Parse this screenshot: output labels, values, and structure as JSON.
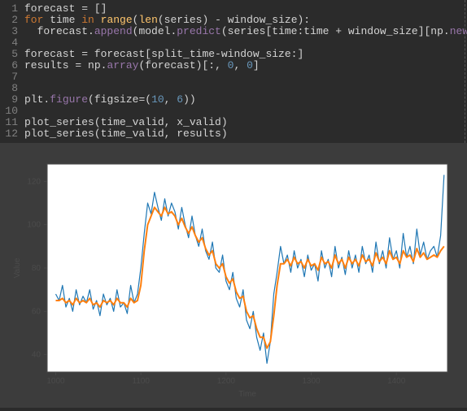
{
  "code": {
    "lines": [
      {
        "n": "1",
        "tokens": [
          {
            "t": "id",
            "v": "forecast "
          },
          {
            "t": "ws",
            "v": "= []"
          }
        ]
      },
      {
        "n": "2",
        "tokens": [
          {
            "t": "kw",
            "v": "for "
          },
          {
            "t": "id",
            "v": "time "
          },
          {
            "t": "kw",
            "v": "in "
          },
          {
            "t": "fn",
            "v": "range"
          },
          {
            "t": "ws",
            "v": "("
          },
          {
            "t": "fn",
            "v": "len"
          },
          {
            "t": "ws",
            "v": "(series) - window_size):"
          }
        ]
      },
      {
        "n": "3",
        "tokens": [
          {
            "t": "ws",
            "v": "  forecast."
          },
          {
            "t": "attr",
            "v": "append"
          },
          {
            "t": "ws",
            "v": "(model."
          },
          {
            "t": "attr",
            "v": "predict"
          },
          {
            "t": "ws",
            "v": "(series[time:time + window_size][np."
          },
          {
            "t": "attr",
            "v": "newaxis"
          },
          {
            "t": "ws",
            "v": "]))"
          }
        ]
      },
      {
        "n": "4",
        "tokens": []
      },
      {
        "n": "5",
        "tokens": [
          {
            "t": "id",
            "v": "forecast "
          },
          {
            "t": "ws",
            "v": "= forecast[split_time-window_size:]"
          }
        ]
      },
      {
        "n": "6",
        "tokens": [
          {
            "t": "id",
            "v": "results "
          },
          {
            "t": "ws",
            "v": "= np."
          },
          {
            "t": "attr",
            "v": "array"
          },
          {
            "t": "ws",
            "v": "(forecast)[:, "
          },
          {
            "t": "num",
            "v": "0"
          },
          {
            "t": "ws",
            "v": ", "
          },
          {
            "t": "num",
            "v": "0"
          },
          {
            "t": "ws",
            "v": "]"
          }
        ]
      },
      {
        "n": "7",
        "tokens": []
      },
      {
        "n": "8",
        "tokens": []
      },
      {
        "n": "9",
        "tokens": [
          {
            "t": "id",
            "v": "plt."
          },
          {
            "t": "attr",
            "v": "figure"
          },
          {
            "t": "ws",
            "v": "("
          },
          {
            "t": "id",
            "v": "figsize"
          },
          {
            "t": "ws",
            "v": "=("
          },
          {
            "t": "num",
            "v": "10"
          },
          {
            "t": "ws",
            "v": ", "
          },
          {
            "t": "num",
            "v": "6"
          },
          {
            "t": "ws",
            "v": "))"
          }
        ]
      },
      {
        "n": "10",
        "tokens": []
      },
      {
        "n": "11",
        "tokens": [
          {
            "t": "id",
            "v": "plot_series(time_valid, x_valid)"
          }
        ]
      },
      {
        "n": "12",
        "tokens": [
          {
            "t": "id",
            "v": "plot_series(time_valid, results)"
          }
        ]
      }
    ]
  },
  "chart_data": {
    "type": "line",
    "xlabel": "Time",
    "ylabel": "Value",
    "xlim": [
      990,
      1460
    ],
    "ylim": [
      32,
      128
    ],
    "xticks": [
      1000,
      1100,
      1200,
      1300,
      1400
    ],
    "yticks": [
      40,
      60,
      80,
      100,
      120
    ],
    "series": [
      {
        "name": "x_valid",
        "color": "#1f77b4",
        "x": [
          1000,
          1004,
          1008,
          1012,
          1016,
          1020,
          1024,
          1028,
          1032,
          1036,
          1040,
          1044,
          1048,
          1052,
          1056,
          1060,
          1064,
          1068,
          1072,
          1076,
          1080,
          1084,
          1088,
          1092,
          1096,
          1100,
          1104,
          1108,
          1112,
          1116,
          1120,
          1124,
          1128,
          1132,
          1136,
          1140,
          1144,
          1148,
          1152,
          1156,
          1160,
          1164,
          1168,
          1172,
          1176,
          1180,
          1184,
          1188,
          1192,
          1196,
          1200,
          1204,
          1208,
          1212,
          1216,
          1220,
          1224,
          1228,
          1232,
          1236,
          1240,
          1244,
          1248,
          1252,
          1256,
          1260,
          1264,
          1268,
          1272,
          1276,
          1280,
          1284,
          1288,
          1292,
          1296,
          1300,
          1304,
          1308,
          1312,
          1316,
          1320,
          1324,
          1328,
          1332,
          1336,
          1340,
          1344,
          1348,
          1352,
          1356,
          1360,
          1364,
          1368,
          1372,
          1376,
          1380,
          1384,
          1388,
          1392,
          1396,
          1400,
          1404,
          1408,
          1412,
          1416,
          1420,
          1424,
          1428,
          1432,
          1436,
          1440,
          1444,
          1448,
          1452,
          1456
        ],
        "y": [
          68,
          65,
          72,
          62,
          66,
          60,
          70,
          63,
          67,
          64,
          70,
          61,
          65,
          58,
          68,
          63,
          66,
          60,
          70,
          62,
          64,
          59,
          72,
          64,
          68,
          80,
          96,
          110,
          105,
          115,
          108,
          102,
          112,
          104,
          110,
          106,
          98,
          108,
          100,
          94,
          104,
          95,
          90,
          98,
          88,
          84,
          92,
          80,
          78,
          86,
          74,
          70,
          78,
          66,
          62,
          70,
          56,
          52,
          60,
          48,
          42,
          50,
          36,
          46,
          68,
          78,
          90,
          82,
          86,
          78,
          88,
          80,
          84,
          76,
          86,
          79,
          82,
          74,
          88,
          80,
          84,
          76,
          90,
          80,
          85,
          77,
          88,
          80,
          86,
          78,
          90,
          82,
          86,
          78,
          92,
          82,
          88,
          80,
          94,
          84,
          88,
          80,
          96,
          85,
          90,
          82,
          98,
          86,
          92,
          84,
          88,
          90,
          85,
          95,
          123
        ]
      },
      {
        "name": "results",
        "color": "#ff7f0e",
        "x": [
          1000,
          1004,
          1008,
          1012,
          1016,
          1020,
          1024,
          1028,
          1032,
          1036,
          1040,
          1044,
          1048,
          1052,
          1056,
          1060,
          1064,
          1068,
          1072,
          1076,
          1080,
          1084,
          1088,
          1092,
          1096,
          1100,
          1104,
          1108,
          1112,
          1116,
          1120,
          1124,
          1128,
          1132,
          1136,
          1140,
          1144,
          1148,
          1152,
          1156,
          1160,
          1164,
          1168,
          1172,
          1176,
          1180,
          1184,
          1188,
          1192,
          1196,
          1200,
          1204,
          1208,
          1212,
          1216,
          1220,
          1224,
          1228,
          1232,
          1236,
          1240,
          1244,
          1248,
          1252,
          1256,
          1260,
          1264,
          1268,
          1272,
          1276,
          1280,
          1284,
          1288,
          1292,
          1296,
          1300,
          1304,
          1308,
          1312,
          1316,
          1320,
          1324,
          1328,
          1332,
          1336,
          1340,
          1344,
          1348,
          1352,
          1356,
          1360,
          1364,
          1368,
          1372,
          1376,
          1380,
          1384,
          1388,
          1392,
          1396,
          1400,
          1404,
          1408,
          1412,
          1416,
          1420,
          1424,
          1428,
          1432,
          1436,
          1440,
          1444,
          1448,
          1452,
          1456
        ],
        "y": [
          65,
          65,
          66,
          64,
          65,
          63,
          66,
          64,
          65,
          64,
          66,
          63,
          64,
          62,
          65,
          64,
          65,
          63,
          66,
          64,
          64,
          62,
          66,
          64,
          65,
          72,
          88,
          100,
          104,
          108,
          106,
          104,
          108,
          105,
          106,
          104,
          100,
          103,
          99,
          96,
          99,
          95,
          92,
          94,
          89,
          86,
          88,
          82,
          80,
          82,
          76,
          73,
          75,
          69,
          66,
          67,
          60,
          57,
          58,
          52,
          48,
          48,
          43,
          46,
          58,
          72,
          82,
          82,
          84,
          81,
          85,
          82,
          83,
          80,
          84,
          81,
          82,
          79,
          85,
          82,
          83,
          80,
          86,
          82,
          84,
          80,
          85,
          82,
          84,
          81,
          86,
          83,
          84,
          81,
          87,
          83,
          85,
          82,
          88,
          84,
          85,
          82,
          88,
          85,
          86,
          83,
          89,
          85,
          87,
          84,
          85,
          86,
          85,
          88,
          90
        ]
      }
    ]
  }
}
